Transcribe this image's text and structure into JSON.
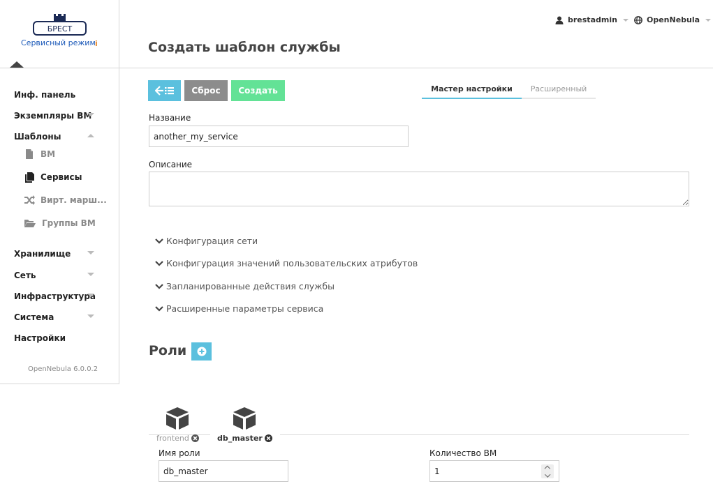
{
  "sidebar": {
    "brand": "БРЕСТ",
    "mode": "Сервисный режим",
    "items": [
      {
        "label": "Инф. панель"
      },
      {
        "label": "Экземпляры ВМ"
      },
      {
        "label": "Шаблоны"
      },
      {
        "label": "Хранилище"
      },
      {
        "label": "Сеть"
      },
      {
        "label": "Инфраструктура"
      },
      {
        "label": "Система"
      },
      {
        "label": "Настройки"
      }
    ],
    "templates_sub": [
      {
        "label": "ВМ",
        "icon": "file-icon"
      },
      {
        "label": "Сервисы",
        "icon": "files-icon"
      },
      {
        "label": "Вирт. марш...",
        "icon": "shuffle-icon"
      },
      {
        "label": "Группы ВМ",
        "icon": "folder-open-icon"
      }
    ],
    "version": "OpenNebula 6.0.0.2"
  },
  "topbar": {
    "user": "brestadmin",
    "zone": "OpenNebula"
  },
  "page": {
    "title": "Создать шаблон службы"
  },
  "buttons": {
    "reset": "Сброс",
    "create": "Создать"
  },
  "tabs": {
    "wizard": "Мастер настройки",
    "advanced": "Расширенный"
  },
  "form": {
    "name_label": "Название",
    "name_value": "another_my_service",
    "description_label": "Описание",
    "description_value": ""
  },
  "sections": [
    {
      "label": "Конфигурация сети"
    },
    {
      "label": "Конфигурация значений пользовательских атрибутов"
    },
    {
      "label": "Запланированные действия службы"
    },
    {
      "label": "Расширенные параметры сервиса"
    }
  ],
  "roles": {
    "title": "Роли",
    "tabs": [
      {
        "label": "frontend"
      },
      {
        "label": "db_master"
      }
    ],
    "role_name_label": "Имя роли",
    "role_name_value": "db_master",
    "vm_count_label": "Количество ВМ",
    "vm_count_value": "1"
  },
  "colors": {
    "accent": "#5bc0de",
    "create": "#63e296",
    "reset": "#8c8c8c",
    "brand": "#1a58b8"
  }
}
